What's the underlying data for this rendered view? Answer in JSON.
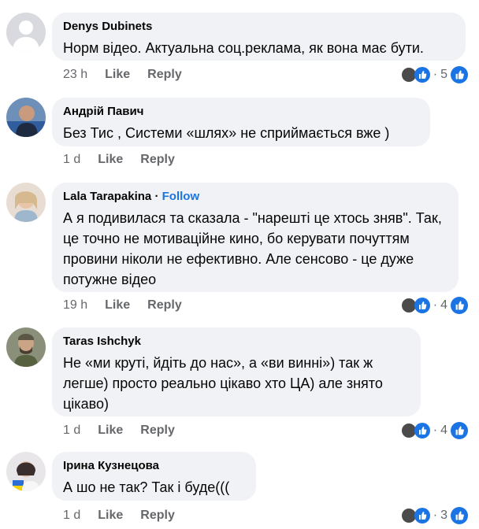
{
  "comments": [
    {
      "author": "Denys Dubinets",
      "text": "Норм відео. Актуальна соц.реклама, як вона має бути.",
      "time": "23 h",
      "like": "Like",
      "reply": "Reply",
      "reaction_count": "5",
      "follow": ""
    },
    {
      "author": "Андрій Павич",
      "text": "Без Тис , Системи «шлях» не сприймається вже )",
      "time": "1 d",
      "like": "Like",
      "reply": "Reply",
      "reaction_count": "",
      "follow": ""
    },
    {
      "author": "Lala  Tarapakina",
      "follow": "Follow",
      "text": "А я подивилася та сказала - \"нарешті це хтось зняв\". Так, це точно не мотиваційне кино, бо керувати почуттям провини ніколи не ефективно. Але  сенсово - це дуже потужне відео",
      "time": "19 h",
      "like": "Like",
      "reply": "Reply",
      "reaction_count": "4"
    },
    {
      "author": "Taras Ishchyk",
      "text": "Не «ми круті, йдіть до нас», а «ви винні») так ж легше) просто реально цікаво хто ЦА) але знято цікаво)",
      "time": "1 d",
      "like": "Like",
      "reply": "Reply",
      "reaction_count": "4",
      "follow": ""
    },
    {
      "author": "Ірина Кузнецова",
      "text": "А шо не так? Так і буде(((",
      "time": "1 d",
      "like": "Like",
      "reply": "Reply",
      "reaction_count": "3",
      "follow": ""
    }
  ],
  "separator": "·",
  "colors": {
    "bubble": "#f0f2f5",
    "meta": "#65676b",
    "accent": "#1b74e4"
  },
  "icons": [
    "default-avatar-icon",
    "like-reaction-icon"
  ]
}
